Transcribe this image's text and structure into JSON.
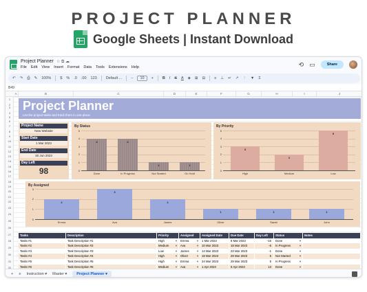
{
  "banner": {
    "title": "PROJECT PLANNER",
    "subtitle": "Google Sheets | Instant Download"
  },
  "window": {
    "doc_title": "Project Planner",
    "title_icons": "☆ ⧉ ☁",
    "menus": [
      "File",
      "Edit",
      "View",
      "Insert",
      "Format",
      "Data",
      "Tools",
      "Extensions",
      "Help"
    ],
    "share_label": "Share",
    "history_icon": "history-icon",
    "comment_icon": "comment-icon"
  },
  "toolbar": {
    "zoom": "100%",
    "currency": "$",
    "percent": "%",
    "decimal_dec": ".0",
    "decimal_inc": ".00",
    "number_format": "123",
    "font": "Default ...",
    "font_size": "10",
    "bold": "B",
    "italic": "I",
    "strike": "S",
    "text_color": "A"
  },
  "formula": {
    "cell_ref": "B49"
  },
  "columns": [
    "A",
    "B",
    "C",
    "D",
    "E",
    "F",
    "G",
    "H",
    "I",
    "J"
  ],
  "rows": [
    "1",
    "2",
    "3",
    "4",
    "5",
    "6",
    "7",
    "8",
    "9",
    "10",
    "11",
    "12",
    "13",
    "14",
    "15",
    "16",
    "17",
    "18",
    "19",
    "20",
    "21",
    "22",
    "23",
    "24",
    "25",
    "26",
    "27",
    "28",
    "29",
    "30",
    "31",
    "32"
  ],
  "planner": {
    "title": "Project Planner",
    "subtitle": "List the project tasks and track them in one place.",
    "project_name_label": "Project Name",
    "project_name": "New Website",
    "start_date_label": "Start Date",
    "start_date": "1 Mar 2023",
    "end_date_label": "End Date",
    "end_date": "30 Jun 2023",
    "day_left_label": "Day Left",
    "day_left": "98"
  },
  "colors": {
    "band": "#a3acd9",
    "panel": "#f1d9c2",
    "status_bar": "#a39191",
    "priority_bar": "#dcaca1",
    "assigned_bar": "#9aa8dc",
    "header_dark": "#3b4059"
  },
  "chart_data": [
    {
      "type": "bar",
      "title": "By Status",
      "categories": [
        "Done",
        "In Progress",
        "Not Started",
        "On Hold"
      ],
      "values": [
        4,
        4,
        1,
        1
      ],
      "ylim": [
        0,
        5
      ],
      "yticks": [
        "0",
        "1",
        "2",
        "3",
        "4",
        "5"
      ],
      "grid": true
    },
    {
      "type": "bar",
      "title": "By Priority",
      "categories": [
        "High",
        "Medium",
        "Low"
      ],
      "values": [
        3,
        2,
        5
      ],
      "ylim": [
        0,
        5
      ],
      "yticks": [
        "0",
        "1",
        "2",
        "3",
        "4",
        "5"
      ],
      "grid": true
    },
    {
      "type": "bar",
      "title": "By Assigned",
      "categories": [
        "Emma",
        "Ava",
        "James",
        "Oliver",
        "Sarah",
        "John"
      ],
      "values": [
        2,
        3,
        2,
        1,
        1,
        1
      ],
      "ylim": [
        0,
        3
      ],
      "yticks": [
        "0",
        "1",
        "2",
        "3"
      ],
      "grid": true
    }
  ],
  "tasks": {
    "headers": [
      "Tasks",
      "Description",
      "Priority",
      "Assigned",
      "Assigned Date",
      "Due Date",
      "Day Left",
      "Status",
      "Notes"
    ],
    "rows": [
      [
        "Tasks #1",
        "Task Description #1",
        "High",
        "Emma",
        "1 Mar 2023",
        "8 Mar 2023",
        "-16",
        "Done",
        ""
      ],
      [
        "Tasks #2",
        "Task Description #2",
        "Medium",
        "Ava",
        "10 Mar 2023",
        "18 Mar 2023",
        "-6",
        "In Progress",
        ""
      ],
      [
        "Tasks #3",
        "Task Description #3",
        "Low",
        "James",
        "14 Mar 2023",
        "23 Mar 2023",
        "-1",
        "Done",
        ""
      ],
      [
        "Tasks #4",
        "Task Description #4",
        "High",
        "Oliver",
        "18 Mar 2023",
        "28 Mar 2023",
        "5",
        "Not Started",
        ""
      ],
      [
        "Tasks #5",
        "Task Description #5",
        "High",
        "Emma",
        "24 Mar 2023",
        "29 Mar 2023",
        "5",
        "In Progress",
        ""
      ],
      [
        "Tasks #6",
        "Task Description #6",
        "Medium",
        "Ava",
        "1 Apr 2023",
        "6 Apr 2023",
        "13",
        "Done",
        ""
      ]
    ]
  },
  "tabs": {
    "add": "+",
    "all_sheets": "≡",
    "items": [
      "Instruction",
      "Master",
      "Project Planner"
    ],
    "active": "Project Planner"
  }
}
